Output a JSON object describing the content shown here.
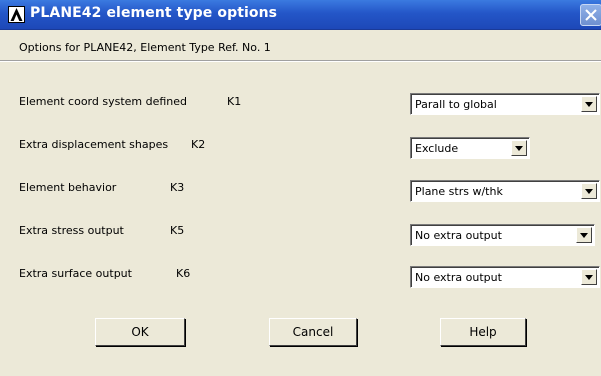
{
  "window": {
    "title": "PLANE42 element type options",
    "close_icon": "close-icon",
    "logo_icon": "ansys-logo-icon"
  },
  "subtitle": "Options for PLANE42, Element Type Ref. No. 1",
  "options": [
    {
      "label": "Element coord system defined",
      "key": "K1",
      "value": "Parall to global"
    },
    {
      "label": "Extra displacement shapes",
      "key": "K2",
      "value": "Exclude"
    },
    {
      "label": "Element behavior",
      "key": "K3",
      "value": "Plane strs w/thk"
    },
    {
      "label": "Extra stress output",
      "key": "K5",
      "value": "No extra output"
    },
    {
      "label": "Extra surface output",
      "key": "K6",
      "value": "No extra output"
    }
  ],
  "buttons": {
    "ok": "OK",
    "cancel": "Cancel",
    "help": "Help"
  },
  "colors": {
    "titlebar": "#2456c8",
    "dialog_bg": "#ece9d8"
  }
}
